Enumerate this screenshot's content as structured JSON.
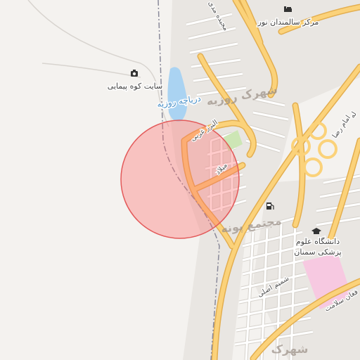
{
  "map": {
    "colors": {
      "land": "#f4f2ef",
      "urban": "#e9e6e2",
      "water": "#aad3f2",
      "park": "#cde6b5",
      "major_road": "#fbd27a",
      "major_road_casing": "#e3ae4f",
      "minor_road": "#ffffff",
      "minor_road_casing": "#d6d2cc",
      "boundary": "#8a8a9a",
      "circle_fill": "#ff6b6b",
      "circle_stroke": "#e35a5a",
      "hospital": "#f7c9e1"
    },
    "labels": {
      "lake": "دریاچه روزیه",
      "district_rouzieh": "شهرک روزیه",
      "district_pouneh": "مجتمع پونه",
      "district_bottom": "شهرک",
      "poi_koh_peymaei": "سایت کوه پیمایی",
      "poi_elderly_center": "مرکز سالمندان نور",
      "poi_university_line1": "دانشگاه علوم",
      "poi_university_line2": "پزشکی سمنان",
      "street_alborz": "البرز غربی",
      "street_milad": "میلاد",
      "street_shamim": "شمیم اصلی",
      "street_emam_reza": "امام رضا",
      "street_top": "مجیده مدی",
      "street_bottom_right": "فغان سلامت",
      "street_edge_right": "له"
    },
    "icons": {
      "camera": "camera-icon",
      "hotel": "bed-icon",
      "fuel": "fuel-icon",
      "school": "graduation-cap-icon"
    }
  }
}
